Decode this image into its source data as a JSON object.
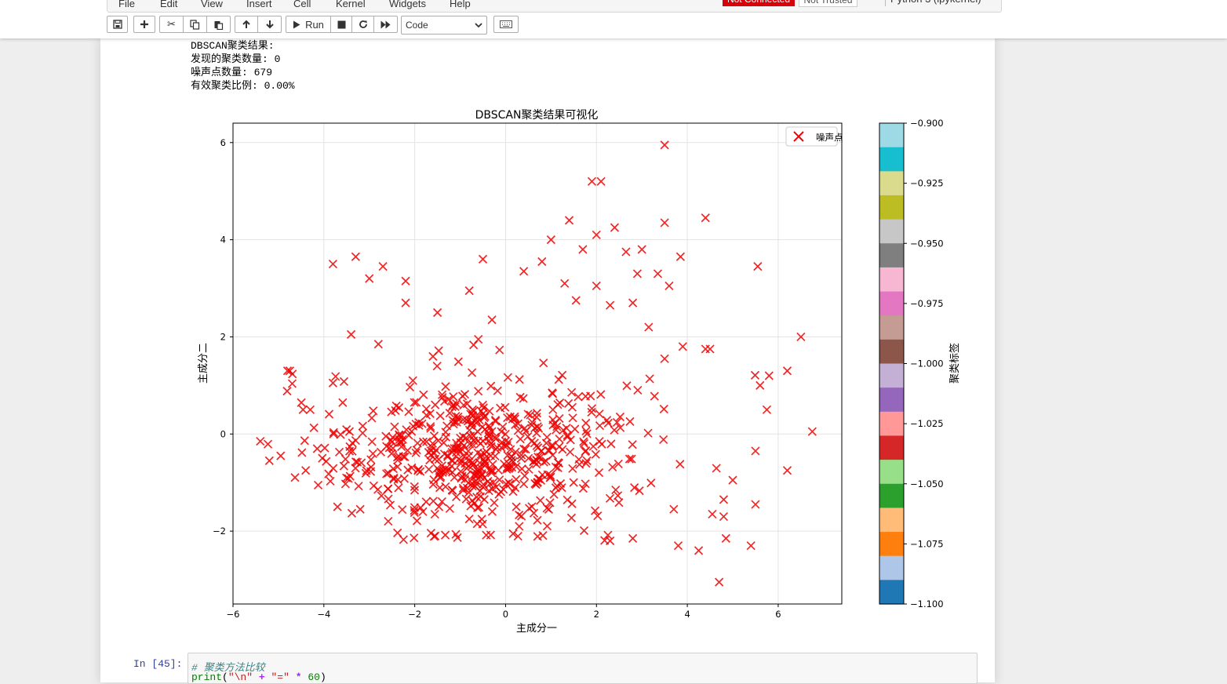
{
  "menubar": {
    "items": [
      "File",
      "Edit",
      "View",
      "Insert",
      "Cell",
      "Kernel",
      "Widgets",
      "Help"
    ],
    "kernel_status": "Not Connected",
    "trust_status": "Not Trusted",
    "kernel_name": "Python 3 (ipykernel)"
  },
  "toolbar": {
    "run_label": "Run",
    "cell_type": "Code"
  },
  "output": {
    "lines": [
      "DBSCAN聚类结果:",
      "发现的聚类数量: 0",
      "噪声点数量: 679",
      "有效聚类比例: 0.00%"
    ]
  },
  "next_cell": {
    "prompt": "In  [45]:",
    "comment": "# 聚类方法比较"
  },
  "colors": {
    "noise": "#ee0000",
    "accent_badge": "#d9000a"
  },
  "chart_data": {
    "type": "scatter",
    "title": "DBSCAN聚类结果可视化",
    "xlabel": "主成分一",
    "ylabel": "主成分二",
    "xlim": [
      -6,
      7.4
    ],
    "ylim": [
      -3.5,
      6.4
    ],
    "xticks": [
      -6,
      -4,
      -2,
      0,
      2,
      4,
      6
    ],
    "yticks": [
      -2,
      0,
      2,
      4,
      6
    ],
    "grid": true,
    "legend": {
      "position": "top-right",
      "entries": [
        {
          "label": "噪声点",
          "marker": "x",
          "color": "#ee0000"
        }
      ]
    },
    "series": [
      {
        "name": "噪声点",
        "marker": "x",
        "count": 679,
        "outliers": [
          [
            3.5,
            5.95
          ],
          [
            1.9,
            5.2
          ],
          [
            2.1,
            5.2
          ],
          [
            1.4,
            4.4
          ],
          [
            2.4,
            4.25
          ],
          [
            3.5,
            4.35
          ],
          [
            4.4,
            4.45
          ],
          [
            2.0,
            4.1
          ],
          [
            1.0,
            4.0
          ],
          [
            -3.3,
            3.65
          ],
          [
            -3.8,
            3.5
          ],
          [
            -0.5,
            3.6
          ],
          [
            -3.0,
            3.2
          ],
          [
            -2.7,
            3.45
          ],
          [
            -2.2,
            3.15
          ],
          [
            0.8,
            3.55
          ],
          [
            1.7,
            3.8
          ],
          [
            2.65,
            3.75
          ],
          [
            3.0,
            3.8
          ],
          [
            3.85,
            3.65
          ],
          [
            5.55,
            3.45
          ],
          [
            -2.2,
            2.7
          ],
          [
            -1.5,
            2.5
          ],
          [
            -0.8,
            2.95
          ],
          [
            -0.3,
            2.35
          ],
          [
            0.4,
            3.35
          ],
          [
            1.3,
            3.1
          ],
          [
            2.0,
            3.05
          ],
          [
            2.9,
            3.3
          ],
          [
            3.35,
            3.3
          ],
          [
            3.6,
            3.05
          ],
          [
            1.55,
            2.75
          ],
          [
            2.3,
            2.65
          ],
          [
            2.8,
            2.7
          ],
          [
            3.15,
            2.2
          ],
          [
            6.5,
            2.0
          ],
          [
            -3.4,
            2.05
          ],
          [
            -2.8,
            1.85
          ],
          [
            -0.6,
            1.95
          ],
          [
            3.5,
            1.55
          ],
          [
            3.9,
            1.8
          ],
          [
            4.4,
            1.75
          ],
          [
            4.5,
            1.75
          ],
          [
            5.6,
            1.0
          ],
          [
            6.2,
            1.3
          ],
          [
            5.8,
            1.2
          ],
          [
            5.75,
            0.5
          ],
          [
            6.75,
            0.05
          ],
          [
            -5.4,
            -0.15
          ],
          [
            -5.2,
            -0.55
          ],
          [
            -4.95,
            -0.45
          ],
          [
            -4.8,
            1.3
          ],
          [
            -4.75,
            1.3
          ],
          [
            -4.4,
            -0.75
          ],
          [
            -3.8,
            1.05
          ],
          [
            -4.3,
            0.5
          ],
          [
            6.2,
            -0.75
          ],
          [
            5.5,
            -0.35
          ],
          [
            5.4,
            -2.3
          ],
          [
            4.7,
            -3.05
          ],
          [
            4.85,
            -2.15
          ],
          [
            4.25,
            -2.4
          ],
          [
            3.8,
            -2.3
          ],
          [
            2.8,
            -2.15
          ],
          [
            2.3,
            -2.2
          ],
          [
            0.3,
            -1.9
          ],
          [
            -0.8,
            -1.75
          ],
          [
            -1.55,
            -2.1
          ],
          [
            -3.2,
            -1.55
          ],
          [
            -3.7,
            -1.5
          ],
          [
            5.0,
            -0.95
          ],
          [
            4.8,
            -1.35
          ],
          [
            5.5,
            -1.45
          ],
          [
            4.55,
            -1.65
          ],
          [
            4.8,
            -1.7
          ]
        ],
        "cluster": {
          "center": [
            -0.6,
            -0.4
          ],
          "spread": [
            1.6,
            0.8
          ]
        }
      }
    ],
    "colorbar": {
      "label": "聚类标签",
      "min": -1.1,
      "max": -0.9,
      "ticks": [
        -0.9,
        -0.925,
        -0.95,
        -0.975,
        -1.0,
        -1.025,
        -1.05,
        -1.075,
        -1.1
      ],
      "tick_labels": [
        "−0.900",
        "−0.925",
        "−0.950",
        "−0.975",
        "−1.000",
        "−1.025",
        "−1.050",
        "−1.075",
        "−1.100"
      ],
      "colors": [
        "#9edae5",
        "#17becf",
        "#dbdb8d",
        "#bcbd22",
        "#c7c7c7",
        "#7f7f7f",
        "#f7b6d2",
        "#e377c2",
        "#c49c94",
        "#8c564b",
        "#c5b0d5",
        "#9467bd",
        "#ff9896",
        "#d62728",
        "#98df8a",
        "#2ca02c",
        "#ffbb78",
        "#ff7f0e",
        "#aec7e8",
        "#1f77b4"
      ]
    }
  }
}
